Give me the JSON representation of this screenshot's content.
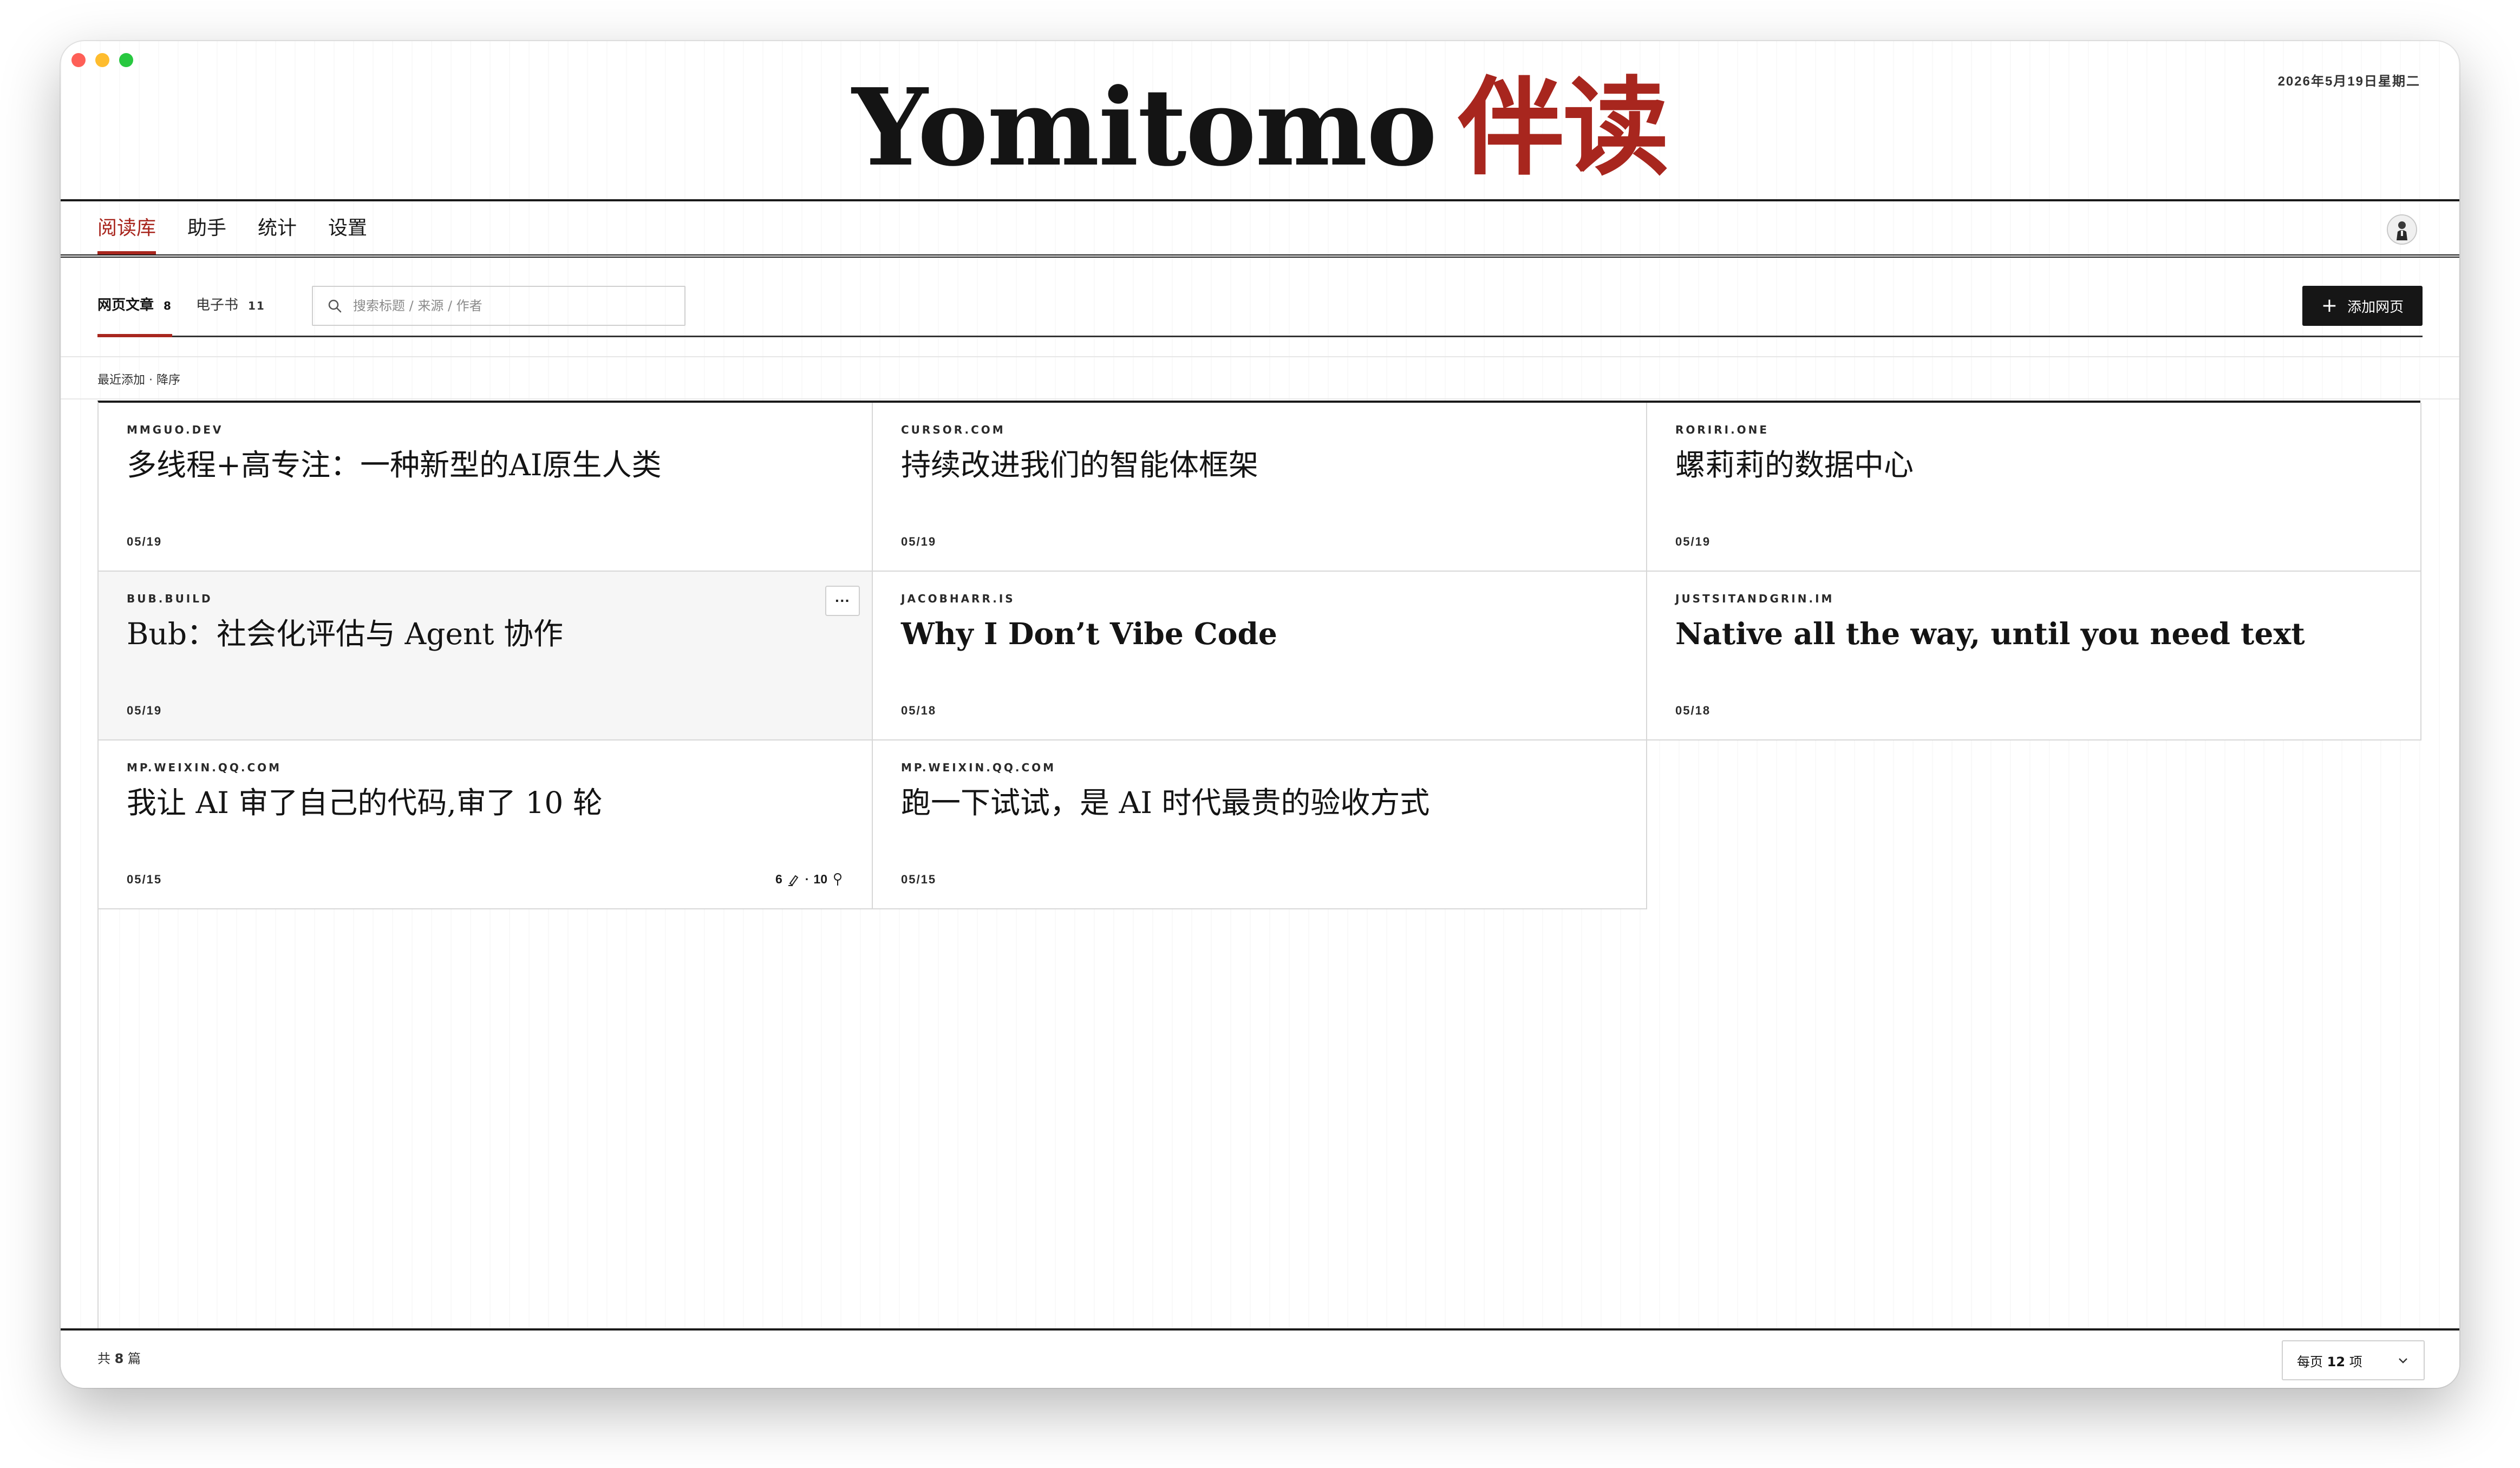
{
  "window": {
    "controls": [
      "close",
      "minimize",
      "zoom"
    ]
  },
  "brand": {
    "name_en": "Yomitomo",
    "name_cn": "伴读",
    "accent_color": "#a8261e"
  },
  "header": {
    "date": "2026年5月19日星期二"
  },
  "nav": {
    "items": [
      {
        "label": "阅读库",
        "active": true
      },
      {
        "label": "助手",
        "active": false
      },
      {
        "label": "统计",
        "active": false
      },
      {
        "label": "设置",
        "active": false
      }
    ],
    "avatar_icon": "user-avatar"
  },
  "library": {
    "tabs": [
      {
        "label": "网页文章",
        "count": "8",
        "active": true
      },
      {
        "label": "电子书",
        "count": "11",
        "active": false
      }
    ],
    "search": {
      "placeholder": "搜索标题 / 来源 / 作者",
      "value": ""
    },
    "add_button": "添加网页",
    "sort_label": "最近添加 · 降序"
  },
  "articles": [
    {
      "source": "mmguo.dev",
      "title": "多线程+高专注：一种新型的AI原生人类",
      "date": "05/19"
    },
    {
      "source": "cursor.com",
      "title": "持续改进我们的智能体框架",
      "date": "05/19"
    },
    {
      "source": "roriri.one",
      "title": "螺莉莉的数据中心",
      "date": "05/19"
    },
    {
      "source": "bub.build",
      "title": "Bub：社会化评估与 Agent 协作",
      "date": "05/19",
      "more_label": "···"
    },
    {
      "source": "jacobharr.is",
      "title": "Why I Don’t Vibe Code",
      "date": "05/18"
    },
    {
      "source": "justsitandgrin.im",
      "title": "Native all the way, until you need text",
      "date": "05/18"
    },
    {
      "source": "mp.weixin.qq.com",
      "title": "我让 AI 审了自己的代码,审了 10 轮",
      "date": "05/15",
      "meta": {
        "highlights": "6",
        "notes": "10"
      }
    },
    {
      "source": "mp.weixin.qq.com",
      "title": "跑一下试试，是 AI 时代最贵的验收方式",
      "date": "05/15"
    }
  ],
  "footer": {
    "total_prefix": "共",
    "total_count": "8",
    "total_suffix": "篇",
    "per_page_label": "每页",
    "per_page_value": "12",
    "per_page_unit": "项"
  }
}
